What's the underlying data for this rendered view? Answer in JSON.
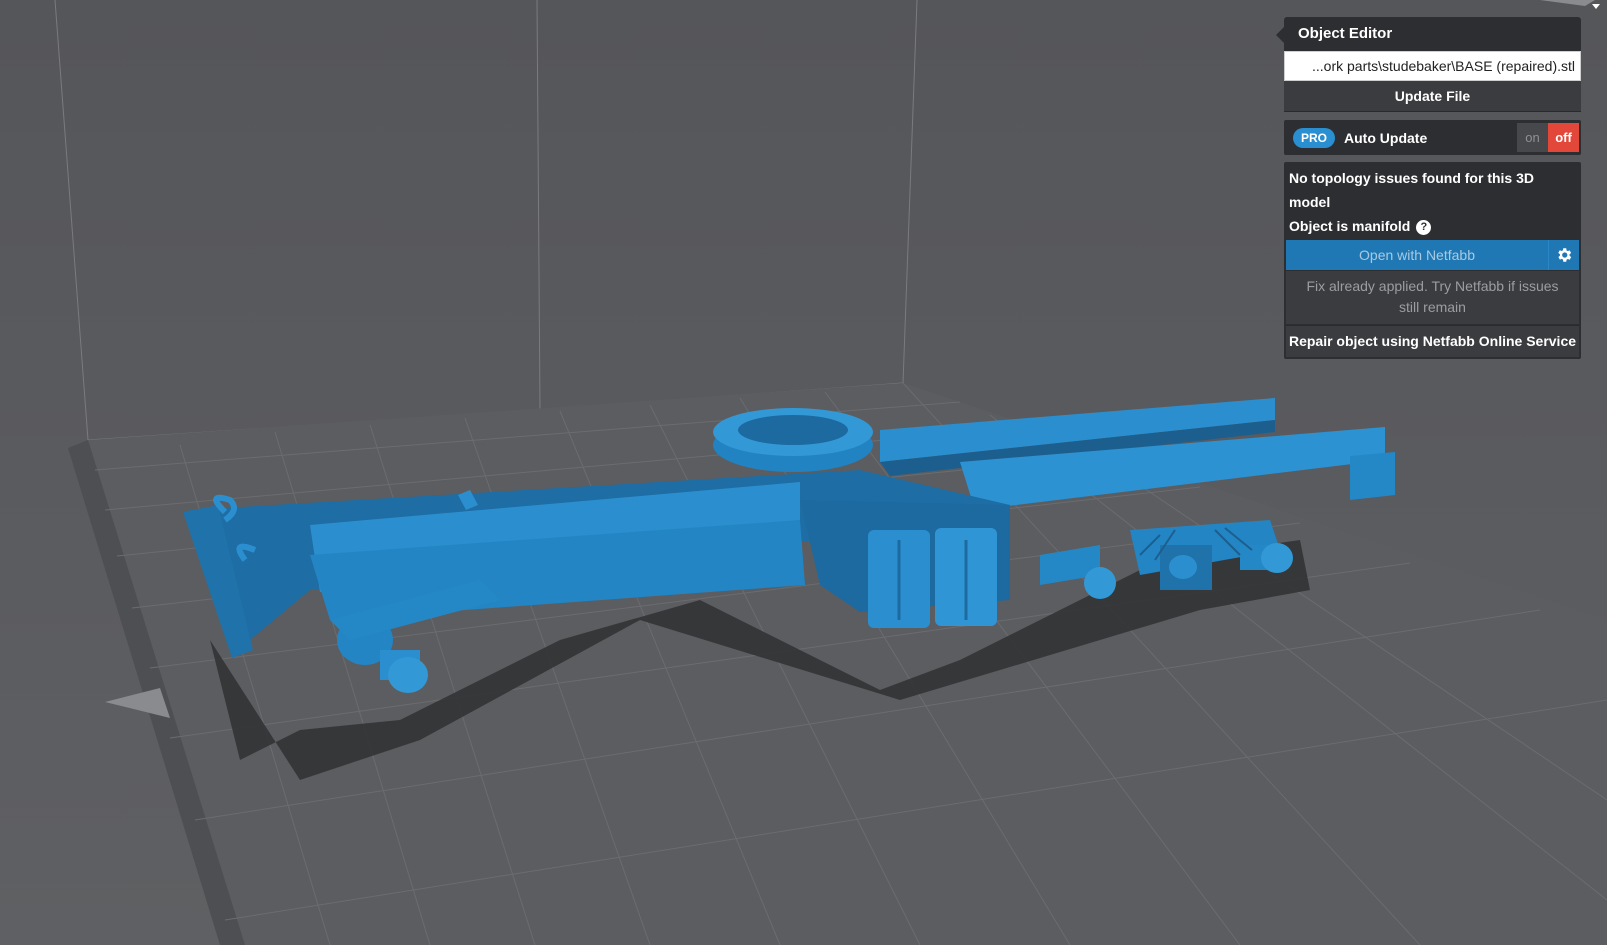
{
  "object_editor": {
    "title": "Object Editor",
    "file_path": "...ork parts\\studebaker\\BASE (repaired).stl",
    "update_file_label": "Update File",
    "auto_update": {
      "badge": "PRO",
      "label": "Auto Update",
      "on_label": "on",
      "off_label": "off",
      "state": "off"
    },
    "topology": {
      "status": "No topology issues found for this 3D model",
      "manifold": "Object is manifold",
      "help_icon": "?"
    },
    "open_netfabb_label": "Open with Netfabb",
    "fix_note": "Fix already applied. Try Netfabb if issues still remain",
    "repair_label": "Repair object using Netfabb Online Service"
  },
  "colors": {
    "model": "#2a8fd0",
    "background": "#5a5b5e",
    "panel": "#2d2e31",
    "toggle_off": "#e2473a",
    "netfabb_button": "#1f78b4"
  },
  "icons": [
    "help-icon",
    "gear-icon"
  ]
}
